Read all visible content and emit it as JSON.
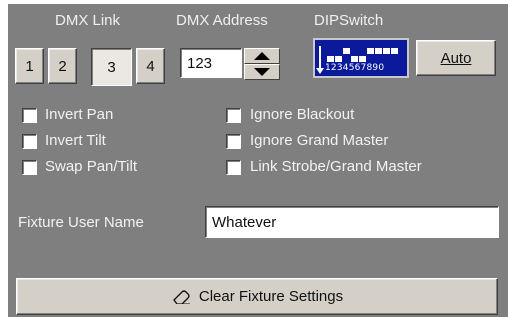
{
  "headers": {
    "dmx_link": "DMX Link",
    "dmx_address": "DMX Address",
    "dipswitch": "DIPSwitch"
  },
  "links": [
    "1",
    "2",
    "3",
    "4"
  ],
  "selected_link": "3",
  "address": {
    "value": "123"
  },
  "dip": {
    "digits": "1234567890"
  },
  "auto_label": "Auto",
  "options_left": [
    "Invert Pan",
    "Invert Tilt",
    "Swap Pan/Tilt"
  ],
  "options_right": [
    "Ignore Blackout",
    "Ignore Grand Master",
    "Link Strobe/Grand Master"
  ],
  "user_name": {
    "label": "Fixture User Name",
    "value": "Whatever"
  },
  "clear_label": "Clear Fixture Settings",
  "icons": {
    "clear": "eraser-icon",
    "spin_up": "arrow-up-icon",
    "spin_down": "arrow-down-icon"
  },
  "colors": {
    "panel": "#7f7f7f",
    "dip_bg": "#0a1a9a",
    "button": "#d4d0c8"
  }
}
